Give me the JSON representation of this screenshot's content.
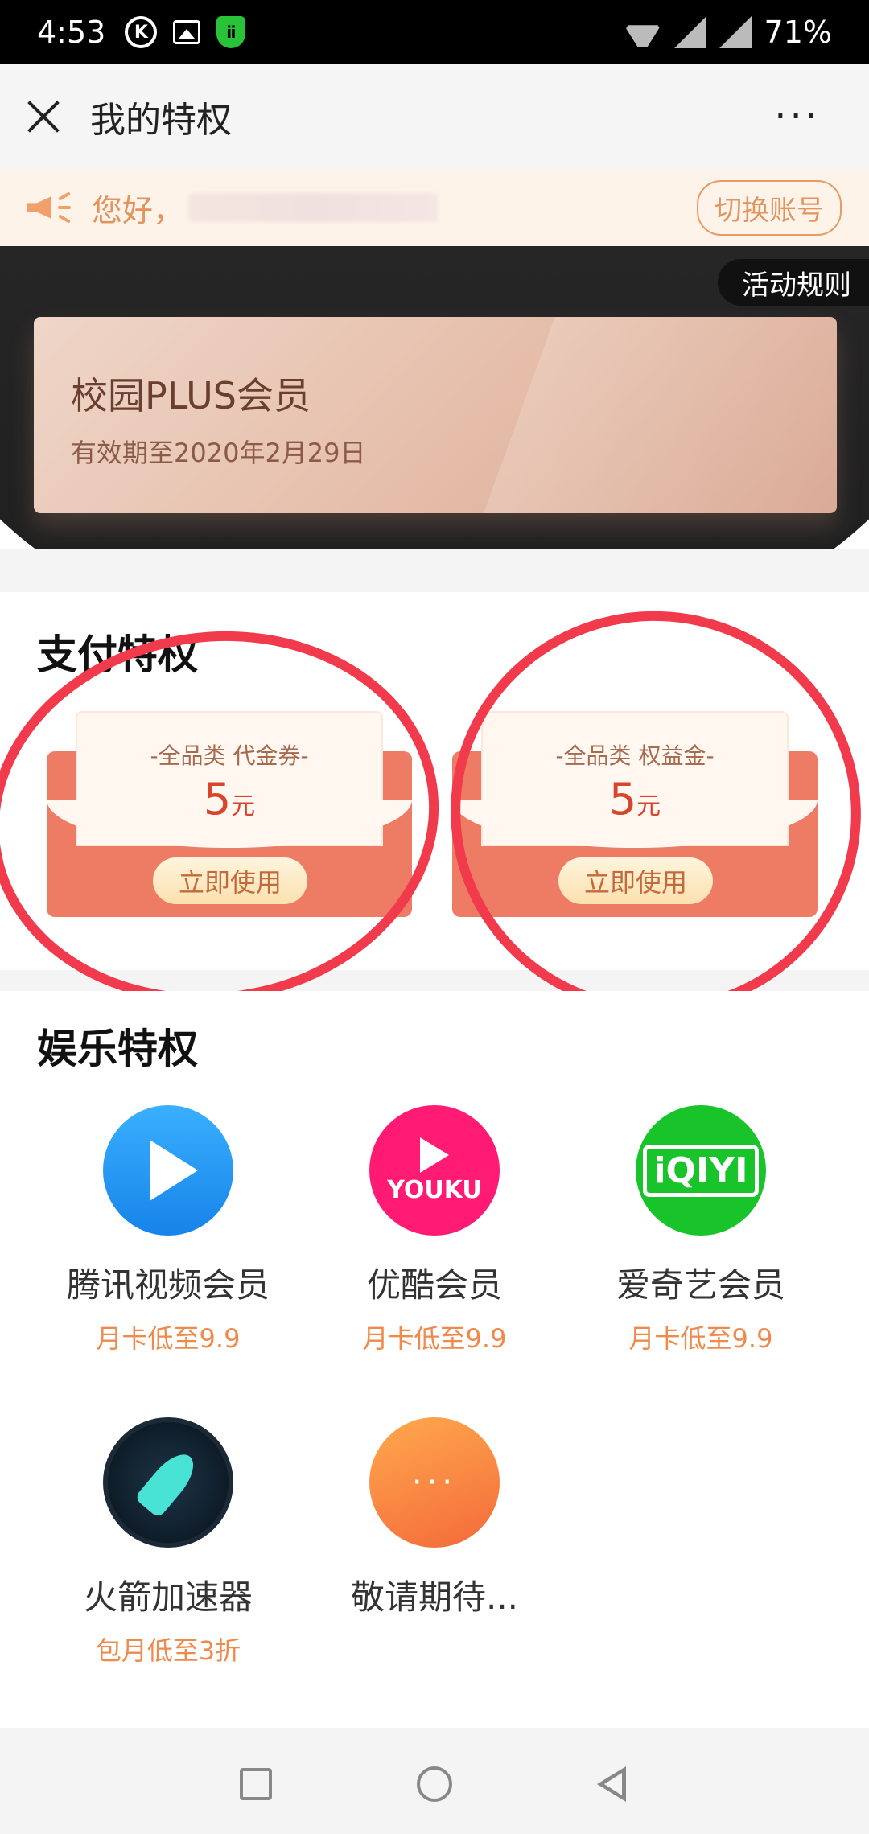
{
  "status_bar": {
    "time": "4:53",
    "battery": "71%",
    "k_badge": "K"
  },
  "header": {
    "title": "我的特权",
    "more": "···"
  },
  "notice": {
    "greeting": "您好，",
    "switch_label": "切换账号"
  },
  "banner": {
    "rules_label": "活动规则",
    "membership_name": "校园PLUS会员",
    "expiry": "有效期至2020年2月29日"
  },
  "pay_section": {
    "title": "支付特权",
    "coupons": [
      {
        "label": "-全品类 代金券-",
        "amount": "5",
        "unit": "元",
        "button": "立即使用"
      },
      {
        "label": "-全品类 权益金-",
        "amount": "5",
        "unit": "元",
        "button": "立即使用"
      }
    ]
  },
  "ent_section": {
    "title": "娱乐特权",
    "apps": [
      {
        "name": "腾讯视频会员",
        "desc": "月卡低至9.9",
        "icon": "tencent-video-icon"
      },
      {
        "name": "优酷会员",
        "desc": "月卡低至9.9",
        "icon": "youku-icon",
        "logo_text": "YOUKU"
      },
      {
        "name": "爱奇艺会员",
        "desc": "月卡低至9.9",
        "icon": "iqiyi-icon",
        "logo_text": "iQIYI"
      },
      {
        "name": "火箭加速器",
        "desc": "包月低至3折",
        "icon": "rocket-icon"
      },
      {
        "name": "敬请期待...",
        "desc": "",
        "icon": "more-icon",
        "logo_text": "···"
      }
    ]
  },
  "colors": {
    "accent": "#ef8a4c",
    "coupon_red": "#ee7b63",
    "annotation_red": "#f13a4b",
    "card_tan": "#e5bda9"
  }
}
